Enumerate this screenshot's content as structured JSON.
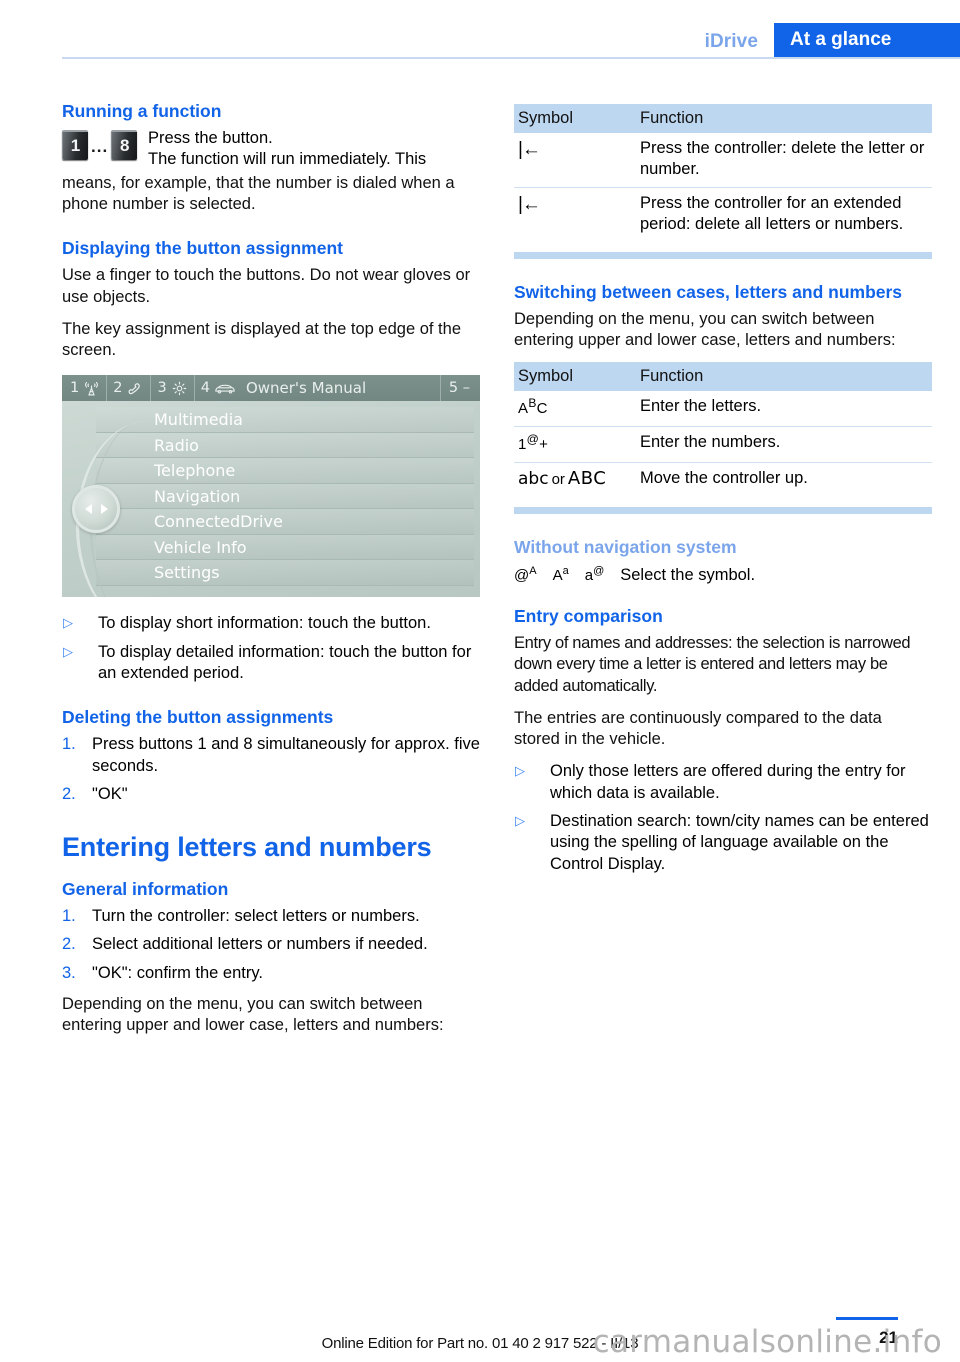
{
  "header": {
    "chapter": "iDrive",
    "section": "At a glance"
  },
  "left_column": {
    "running_heading": "Running a function",
    "keycaps": {
      "first": "1",
      "dots": "...",
      "last": "8"
    },
    "running_line1": "Press the button.",
    "running_line2": "The function will run immediately. This",
    "running_rest": "means, for example, that the number is dialed when a phone number is selected.",
    "displaying_heading": "Displaying the button assignment",
    "displaying_p1": "Use a finger to touch the buttons. Do not wear gloves or use objects.",
    "displaying_p2": "The key assignment is displayed at the top edge of the screen.",
    "display_mock": {
      "topbar": [
        {
          "number": "1",
          "icon": "radio-tower-icon"
        },
        {
          "number": "2",
          "icon": "telephone-handset-icon"
        },
        {
          "number": "3",
          "icon": "gear-icon"
        },
        {
          "number": "4",
          "icon": "car-icon",
          "label": "Owner's Manual"
        }
      ],
      "right_label": "5 –",
      "menu_items": [
        "Multimedia",
        "Radio",
        "Telephone",
        "Navigation",
        "ConnectedDrive",
        "Vehicle Info",
        "Settings"
      ]
    },
    "display_bullets": [
      "To display short information: touch the button.",
      "To display detailed information: touch the button for an extended period."
    ],
    "deleting_heading": "Deleting the button assignments",
    "deleting_steps": [
      {
        "marker": "1.",
        "text": "Press buttons 1 and 8 simultaneously for approx. five seconds."
      },
      {
        "marker": "2.",
        "text": "\"OK\""
      }
    ],
    "entering_title": "Entering letters and numbers",
    "general_heading": "General information",
    "general_steps": [
      {
        "marker": "1.",
        "text": "Turn the controller: select letters or numbers."
      },
      {
        "marker": "2.",
        "text": "Select additional letters or numbers if needed."
      },
      {
        "marker": "3.",
        "text": "\"OK\": confirm the entry."
      }
    ],
    "general_closing": "Depending on the menu, you can switch between entering upper and lower case, letters and numbers:"
  },
  "right_column": {
    "table1": {
      "columns": [
        "Symbol",
        "Function"
      ],
      "rows": [
        {
          "symbol": "|←",
          "function": "Press the controller: delete the letter or number."
        },
        {
          "symbol": "|←",
          "function": "Press the controller for an extended period: delete all letters or numbers."
        }
      ]
    },
    "switching_heading": "Switching between cases, letters and numbers",
    "switching_text": "Depending on the menu, you can switch between entering upper and lower case, letters and numbers:",
    "table2": {
      "columns": [
        "Symbol",
        "Function"
      ],
      "rows": [
        {
          "symbol_parts": {
            "a": "A",
            "sup": "B",
            "b": "C"
          },
          "function": "Enter the letters."
        },
        {
          "symbol_parts": {
            "a": "1",
            "sup": "@",
            "b": "+"
          },
          "function": "Enter the numbers."
        },
        {
          "symbol_lower": "abc",
          "symbol_or": "or",
          "symbol_upper": "ABC",
          "function": "Move the controller up."
        }
      ]
    },
    "without_nav_heading": "Without navigation system",
    "without_nav_symbols": [
      {
        "base": "@",
        "sup": "A"
      },
      {
        "base": "A",
        "sup": "a"
      },
      {
        "base": "a",
        "sup": "@"
      }
    ],
    "without_nav_text": "Select the symbol.",
    "entry_heading": "Entry comparison",
    "entry_p1": "Entry of names and addresses: the selection is narrowed down every time a letter is entered and letters may be added automatically.",
    "entry_p2": "The entries are continuously compared to the data stored in the vehicle.",
    "entry_bullets": [
      "Only those letters are offered during the entry for which data is available.",
      "Destination search: town/city names can be entered using the spelling of language available on the Control Display."
    ]
  },
  "footer": {
    "edition": "Online Edition for Part no. 01 40 2 917 522 - II/13",
    "page_number": "21",
    "watermark": "carmanualsonline.info"
  },
  "colors": {
    "brand_blue": "#1163e8",
    "light_blue": "#7ba5ea",
    "table_header": "#bdd7f0",
    "rule_blue": "#c8d9f2"
  }
}
